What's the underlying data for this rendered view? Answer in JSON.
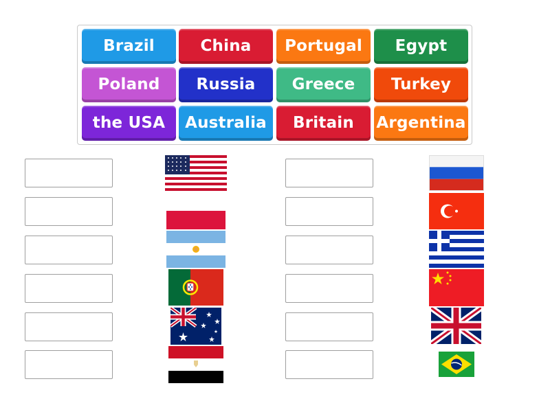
{
  "word_bank": {
    "tiles": [
      {
        "label": "Brazil",
        "color": "#1f9ae6"
      },
      {
        "label": "China",
        "color": "#d91c33"
      },
      {
        "label": "Portugal",
        "color": "#fb7812"
      },
      {
        "label": "Egypt",
        "color": "#1e8f4a"
      },
      {
        "label": "Poland",
        "color": "#c455d4"
      },
      {
        "label": "Russia",
        "color": "#2231c9"
      },
      {
        "label": "Greece",
        "color": "#3fba86"
      },
      {
        "label": "Turkey",
        "color": "#f04a0b"
      },
      {
        "label": "the USA",
        "color": "#7d26d9"
      },
      {
        "label": "Australia",
        "color": "#1f9ae6"
      },
      {
        "label": "Britain",
        "color": "#d91c33"
      },
      {
        "label": "Argentina",
        "color": "#fb7812"
      }
    ]
  },
  "drop_targets": {
    "left_column": [
      {
        "flag": "usa-flag",
        "value": ""
      },
      {
        "flag": "poland-flag",
        "value": ""
      },
      {
        "flag": "argentina-flag",
        "value": ""
      },
      {
        "flag": "portugal-flag",
        "value": ""
      },
      {
        "flag": "australia-flag",
        "value": ""
      },
      {
        "flag": "egypt-flag",
        "value": ""
      }
    ],
    "right_column": [
      {
        "flag": "russia-flag",
        "value": ""
      },
      {
        "flag": "turkey-flag",
        "value": ""
      },
      {
        "flag": "greece-flag",
        "value": ""
      },
      {
        "flag": "china-flag",
        "value": ""
      },
      {
        "flag": "britain-flag",
        "value": ""
      },
      {
        "flag": "brazil-flag",
        "value": ""
      }
    ]
  }
}
